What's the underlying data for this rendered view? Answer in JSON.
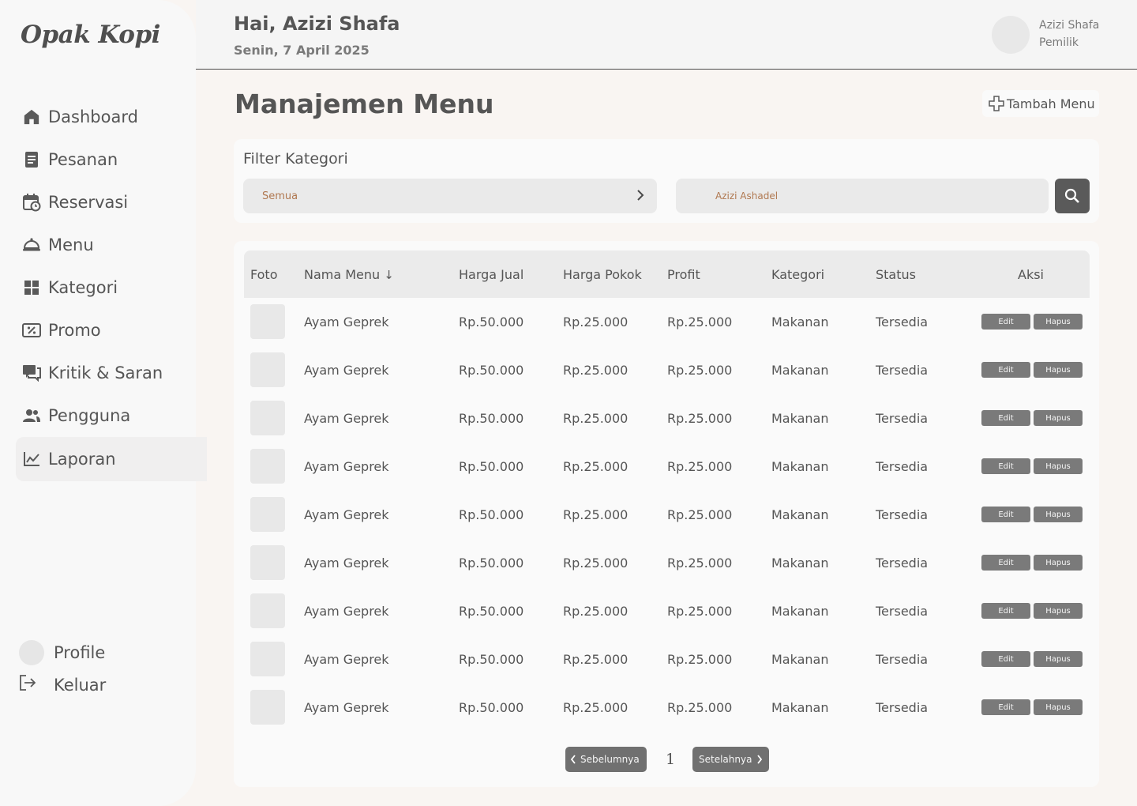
{
  "app": {
    "logo": "Opak Kopi"
  },
  "sidebar": {
    "items": [
      {
        "label": "Dashboard",
        "icon": "home-icon"
      },
      {
        "label": "Pesanan",
        "icon": "receipt-icon"
      },
      {
        "label": "Reservasi",
        "icon": "calendar-clock-icon"
      },
      {
        "label": "Menu",
        "icon": "cloche-icon"
      },
      {
        "label": "Kategori",
        "icon": "grid-icon"
      },
      {
        "label": "Promo",
        "icon": "coupon-icon"
      },
      {
        "label": "Kritik & Saran",
        "icon": "chat-icon"
      },
      {
        "label": "Pengguna",
        "icon": "users-icon"
      },
      {
        "label": "Laporan",
        "icon": "chart-line-icon",
        "active": true
      }
    ],
    "profile_label": "Profile",
    "logout_label": "Keluar"
  },
  "header": {
    "greeting": "Hai, Azizi Shafa",
    "date": "Senin, 7 April 2025",
    "user_name": "Azizi Shafa",
    "user_role": "Pemilik"
  },
  "main": {
    "title": "Manajemen Menu",
    "add_button": "Tambah Menu",
    "filter": {
      "title": "Filter Kategori",
      "selected": "Semua",
      "search_value": "Azizi Ashadel"
    },
    "table": {
      "columns": [
        "Foto",
        "Nama Menu",
        "Harga Jual",
        "Harga Pokok",
        "Profit",
        "Kategori",
        "Status",
        "Aksi"
      ],
      "sort_indicator": "↓",
      "edit_label": "Edit",
      "delete_label": "Hapus",
      "rows": [
        {
          "name": "Ayam Geprek",
          "price": "Rp.50.000",
          "cost": "Rp.25.000",
          "profit": "Rp.25.000",
          "category": "Makanan",
          "status": "Tersedia"
        },
        {
          "name": "Ayam Geprek",
          "price": "Rp.50.000",
          "cost": "Rp.25.000",
          "profit": "Rp.25.000",
          "category": "Makanan",
          "status": "Tersedia"
        },
        {
          "name": "Ayam Geprek",
          "price": "Rp.50.000",
          "cost": "Rp.25.000",
          "profit": "Rp.25.000",
          "category": "Makanan",
          "status": "Tersedia"
        },
        {
          "name": "Ayam Geprek",
          "price": "Rp.50.000",
          "cost": "Rp.25.000",
          "profit": "Rp.25.000",
          "category": "Makanan",
          "status": "Tersedia"
        },
        {
          "name": "Ayam Geprek",
          "price": "Rp.50.000",
          "cost": "Rp.25.000",
          "profit": "Rp.25.000",
          "category": "Makanan",
          "status": "Tersedia"
        },
        {
          "name": "Ayam Geprek",
          "price": "Rp.50.000",
          "cost": "Rp.25.000",
          "profit": "Rp.25.000",
          "category": "Makanan",
          "status": "Tersedia"
        },
        {
          "name": "Ayam Geprek",
          "price": "Rp.50.000",
          "cost": "Rp.25.000",
          "profit": "Rp.25.000",
          "category": "Makanan",
          "status": "Tersedia"
        },
        {
          "name": "Ayam Geprek",
          "price": "Rp.50.000",
          "cost": "Rp.25.000",
          "profit": "Rp.25.000",
          "category": "Makanan",
          "status": "Tersedia"
        },
        {
          "name": "Ayam Geprek",
          "price": "Rp.50.000",
          "cost": "Rp.25.000",
          "profit": "Rp.25.000",
          "category": "Makanan",
          "status": "Tersedia"
        }
      ]
    },
    "pagination": {
      "prev": "Sebelumnya",
      "page": "1",
      "next": "Setelahnya"
    }
  }
}
